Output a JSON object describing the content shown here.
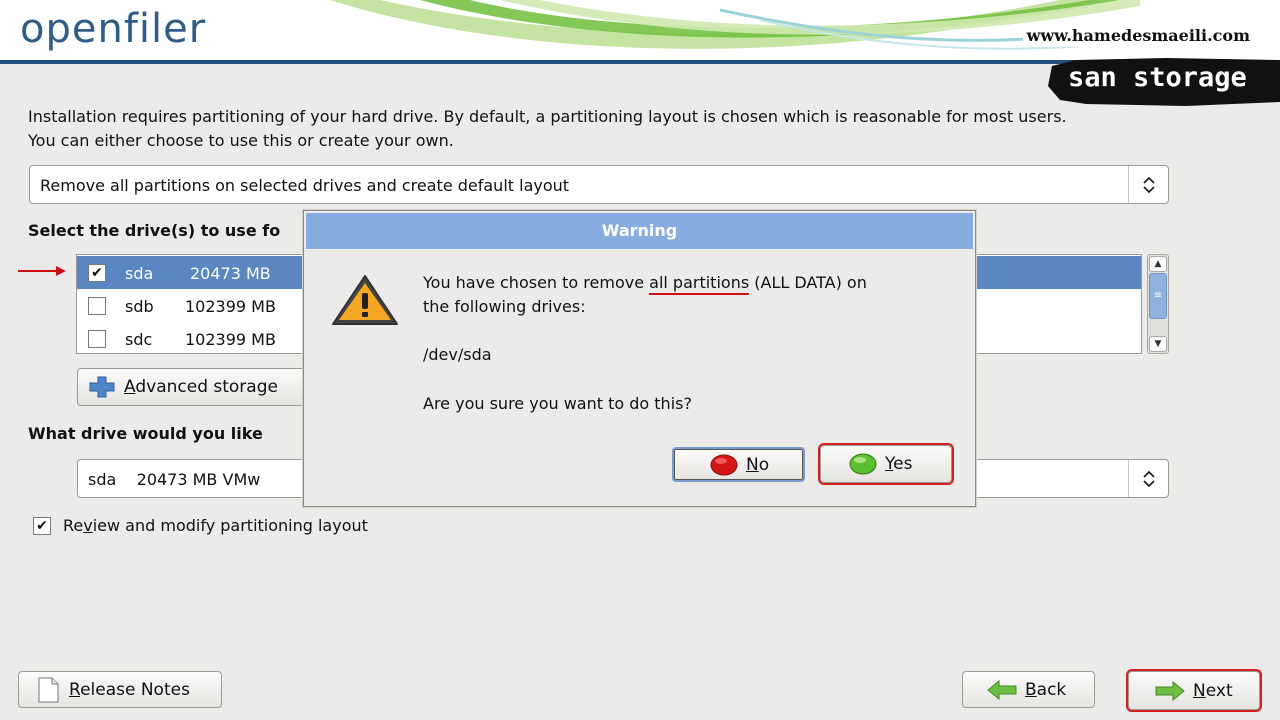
{
  "header": {
    "logo_text": "openfiler",
    "watermark_url": "www.hamedesmaeili.com",
    "watermark_badge": "san storage"
  },
  "intro": {
    "line1": "Installation requires partitioning of your hard drive.  By default, a partitioning layout is chosen which is reasonable for most users.",
    "line2": "You can either choose to use this or create your own."
  },
  "layout_combo": {
    "value": "Remove all partitions on selected drives and create default layout"
  },
  "select_drives_label": "Select the drive(s) to use fo",
  "drives": [
    {
      "name": "sda",
      "size": "20473 MB",
      "checked": true,
      "selected": true
    },
    {
      "name": "sdb",
      "size": "102399 MB",
      "checked": false,
      "selected": false
    },
    {
      "name": "sdc",
      "size": "102399 MB",
      "checked": false,
      "selected": false
    }
  ],
  "advanced_storage": {
    "label_prefix": "A",
    "label_rest": "dvanced storage"
  },
  "boot_drive_label": "What drive would you like",
  "boot_combo": {
    "value": "sda    20473 MB VMw"
  },
  "review": {
    "checked": true,
    "label_pre": "Re",
    "label_mnemonic": "v",
    "label_post": "iew and modify partitioning layout"
  },
  "buttons": {
    "release_notes_mn": "R",
    "release_notes_rest": "elease Notes",
    "back_mn": "B",
    "back_rest": "ack",
    "next_mn": "N",
    "next_rest": "ext"
  },
  "dialog": {
    "title": "Warning",
    "msg_before": "You have chosen to remove ",
    "msg_emph": "all partitions",
    "msg_after": " (ALL DATA) on",
    "msg_line2": "the following drives:",
    "device": "/dev/sda",
    "question": "Are you sure you want to do this?",
    "no_mn": "N",
    "no_rest": "o",
    "yes_mn": "Y",
    "yes_rest": "es"
  },
  "colors": {
    "accent_blue": "#5a86c2",
    "dialog_title": "#89ace0",
    "highlight_red": "#d62020"
  }
}
